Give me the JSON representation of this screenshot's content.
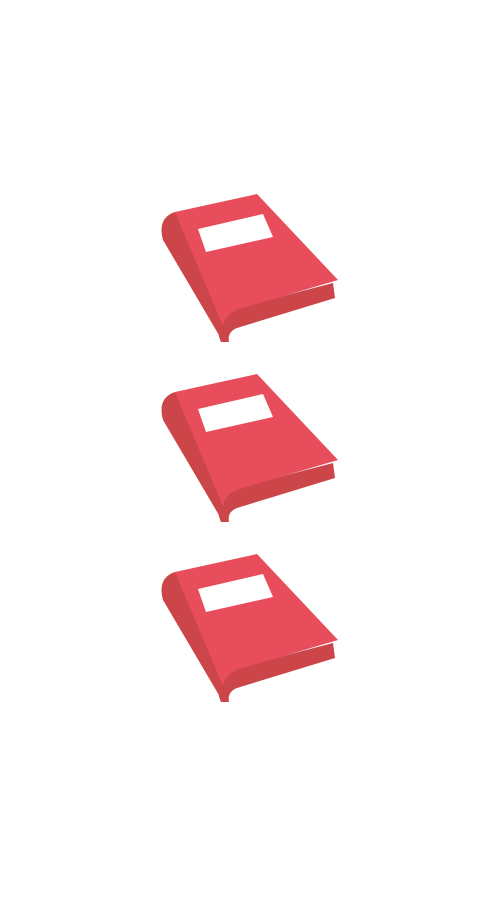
{
  "colors": {
    "background": "#ffffff",
    "cover": "#e84d5b",
    "spine": "#cc4649",
    "pages": "#e5eaef",
    "page_lines": "#a9b5bd",
    "label": "#ffffff"
  },
  "icons": [
    {
      "name": "red-book-icon"
    },
    {
      "name": "red-book-icon"
    },
    {
      "name": "red-book-icon"
    }
  ]
}
